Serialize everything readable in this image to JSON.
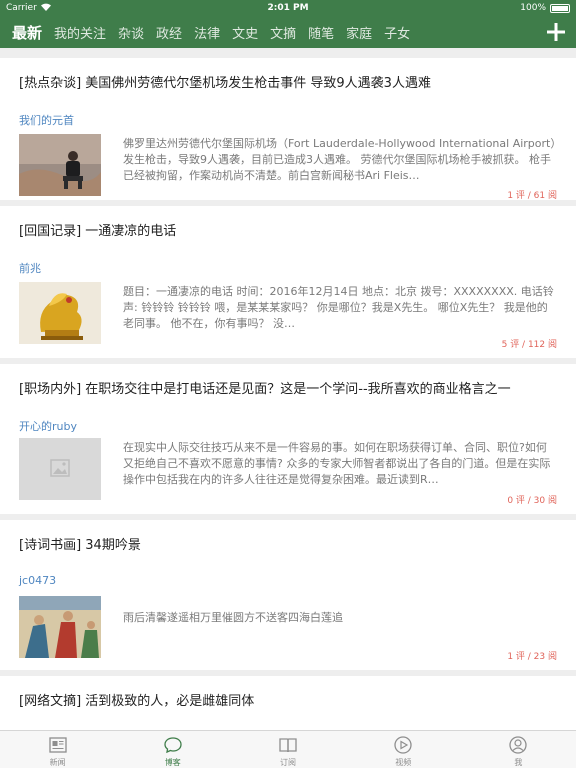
{
  "status_bar": {
    "carrier": "Carrier",
    "time": "2:01 PM",
    "battery": "100%"
  },
  "nav": {
    "tabs": [
      {
        "label": "最新",
        "active": true
      },
      {
        "label": "我的关注"
      },
      {
        "label": "杂谈"
      },
      {
        "label": "政经"
      },
      {
        "label": "法律"
      },
      {
        "label": "文史"
      },
      {
        "label": "文摘"
      },
      {
        "label": "随笔"
      },
      {
        "label": "家庭"
      },
      {
        "label": "子女"
      }
    ],
    "add_icon": "plus-icon"
  },
  "articles": [
    {
      "title": "[热点杂谈] 美国佛州劳德代尔堡机场发生枪击事件 导致9人遇袭3人遇难",
      "author": "我们的元首",
      "summary": "佛罗里达州劳德代尔堡国际机场（Fort Lauderdale-Hollywood International Airport）发生枪击，导致9人遇袭，目前已造成3人遇难。  劳德代尔堡国际机场枪手被抓获。  枪手已经被拘留，作案动机尚不清楚。前白宫新闻秘书Ari Fleis…",
      "stats": "1 评 / 61 阅",
      "thumb": "photo-man-sitting"
    },
    {
      "title": "[回国记录] 一通凄凉的电话",
      "author": "前兆",
      "summary": "题目：一通凄凉的电话   时间：2016年12月14日    地点：北京    拨号：XXXXXXXX. 电话铃声: 铃铃铃   铃铃铃       喂，是某某某家吗？    你是哪位？我是X先生。    哪位X先生？    我是他的老同事。    他不在，你有事吗？    没…",
      "stats": "5 评 / 112 阅",
      "thumb": "photo-golden-rooster"
    },
    {
      "title": "[职场内外] 在职场交往中是打电话还是见面？这是一个学问--我所喜欢的商业格言之一",
      "author": "开心的ruby",
      "summary": "在现实中人际交往技巧从来不是一件容易的事。如何在职场获得订单、合同、职位?如何又拒绝自己不喜欢不愿意的事情? 众多的专家大师智者都说出了各自的门道。但是在实际操作中包括我在内的许多人往往还是觉得复杂困难。最近读到R…",
      "stats": "0 评 / 30 阅",
      "thumb": "placeholder-image-icon"
    },
    {
      "title": "[诗词书画] 34期吟景",
      "author": "jc0473",
      "summary": "雨后清馨遂遥相万里催圆方不送客四海白莲追",
      "stats": "1 评 / 23 阅",
      "thumb": "photo-painting"
    },
    {
      "title": "[网络文摘] 活到极致的人，必是雌雄同体",
      "author": "",
      "summary": "",
      "stats": "",
      "thumb": ""
    }
  ],
  "tab_bar": [
    {
      "label": "新闻",
      "icon": "newspaper-icon"
    },
    {
      "label": "博客",
      "icon": "chat-bubble-icon",
      "active": true
    },
    {
      "label": "订阅",
      "icon": "book-icon"
    },
    {
      "label": "视频",
      "icon": "play-icon"
    },
    {
      "label": "我",
      "icon": "person-icon"
    }
  ],
  "colors": {
    "accent": "#3f7d4a",
    "author": "#4f86c0",
    "stats": "#e0645a"
  }
}
